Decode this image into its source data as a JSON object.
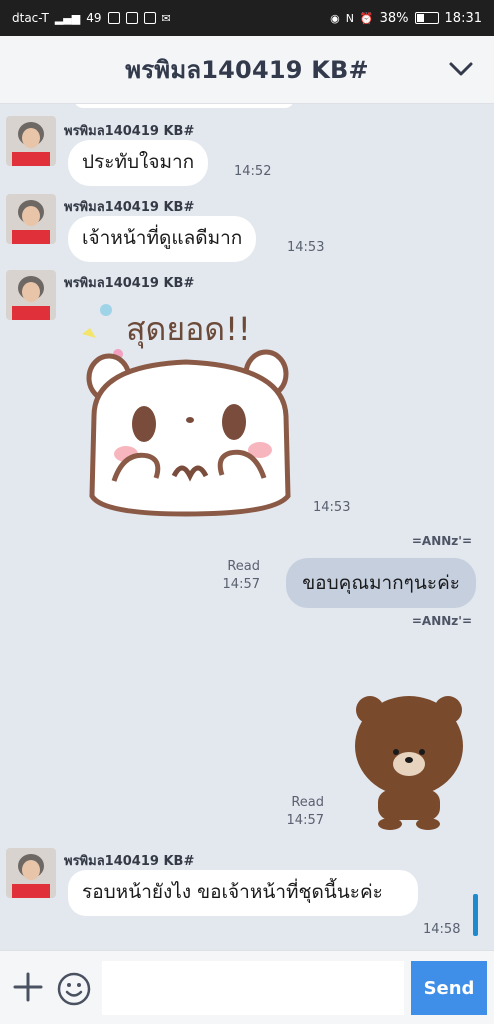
{
  "status_bar": {
    "carrier": "dtac-T",
    "network": "4G",
    "notif_count": "49",
    "battery": "38%",
    "time": "18:31"
  },
  "header": {
    "title": "พรพิมล140419 KB#"
  },
  "messages": [
    {
      "sender": "พรพิมล140419 KB#",
      "text": "ประทับใจมาก",
      "time": "14:52"
    },
    {
      "sender": "พรพิมล140419 KB#",
      "text": "เจ้าหน้าที่ดูแลดีมาก",
      "time": "14:53"
    },
    {
      "sender": "พรพิมล140419 KB#",
      "sticker_text": "สุดยอด!!",
      "time": "14:53"
    },
    {
      "sender": "=ANNz'=",
      "read": "Read",
      "time": "14:57",
      "text": "ขอบคุณมากๆนะค่ะ"
    },
    {
      "sender": "=ANNz'=",
      "read": "Read",
      "time": "14:57"
    },
    {
      "sender": "พรพิมล140419 KB#",
      "text": "รอบหน้ายังไง ขอเจ้าหน้าที่ชุดนี้นะค่ะ",
      "time": "14:58"
    }
  ],
  "input": {
    "placeholder": "",
    "send_label": "Send"
  },
  "icons": {
    "chevron": "chevron-down-icon",
    "plus": "plus-icon",
    "emoji": "emoji-icon"
  },
  "colors": {
    "chat_bg": "#e3e7ee",
    "incoming_bubble": "#ffffff",
    "outgoing_bubble": "#c5cfde",
    "send_button": "#3f8ee8",
    "header_title": "#323a4b"
  }
}
